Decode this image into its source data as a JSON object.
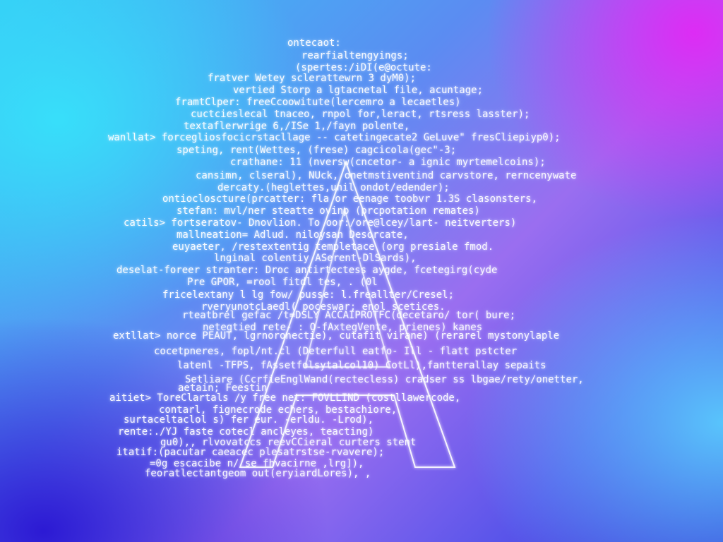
{
  "artwork": {
    "emblem_icon": "letter-a-outline-icon",
    "colors": {
      "text": "#ffffff",
      "cyan": "#37e1fa",
      "magenta": "#e128f5",
      "violet": "#9a6ef0",
      "indigo": "#3a36d8"
    },
    "lines": [
      "ontecaot:",
      "rearfialtengyings;",
      "(spertes:/iDI(e@octute:",
      "fratver Wetey sclerattewrn 3 dyM0);",
      "vertied Storp a lgtacnetal file, acuntage;",
      "framtClper: freeCcoowitute(lercemro a lecaetles)",
      "cuctcieslecal tnaceo, rnpol for,leract, rtsress lasster);",
      "textaflerwrige 6,/ISe 1,/fayn polente,",
      "wanllat> forcegliosfocicrstacllage -- catetingecate2 GeLuve\" fresCliepiyp0);",
      "speting, rent(Wettes, (frese) cagcicola(gec\"-3;",
      "crathane: 11 (nversw(cncetor- a ignic myrtemelcoins);",
      "cansimn, clseral), NUck, onetmstiventind carvstore, rerncenywate",
      "dercaty.(heglettes,unil ondot/edender);",
      "ontiocloscture(prcatter: fla or eenage toobvr 1.3S clasonsters,",
      "stefan: mvl/ner steatte ovinp (prcpotation remates)",
      "catils> fortseratov- Dnovlion. To oor:/ore@lcey/lart- neitverters)",
      "mallneation= Adlud. niloysan Desorcate,",
      "euyaeter, /restextentig templetace (org presiale fmod.",
      "lnginal colentiy ASerent-DlSards),",
      "deselat-foreer stranter: Droc antirtectess aygde, fcetegirg(cyde",
      "Pre GPOR, =rool fitdl tes, . (0l",
      "fricelextany l lg fow/ pusse: l.freallter/Cresel;",
      "rveryunotcLaedl( poceswar; enol scetices.",
      "rteatbrel gefac /t=DSLY ACCAIPROTFC(decetaro/ tor( bure;",
      "netegtied rete- : O-fAxtegVente, prienes) kanes",
      "extllat> norce PEAUT, lgrnoronectie), cutafit virane) (rerarel mystonylaple",
      "cocetpneres, fopl/nt.cl (Deterfull eatfo- Ill - flatt pstcter",
      "latenl -TFPS, fAssetfolsytalcol10) CotLl),fantterallay sepaits",
      "Setliare (CcrfieEnglWand(rectecless) cradser ss lbgae/rety/onetter,",
      "aetain; Feestin",
      "aitiet> ToreClartals /y free net: FOVLLIND (costllawercode,",
      "contarl, fignecrode echers, bestachiore,",
      "surtaceltaclol s) fer eur. -erldu. -Lrod),",
      "rente:./YJ faste cotecl ancleyes, teacting)",
      "gu0),, rlvovatccs reevCCieral curters stent",
      "itatif:(pacutar caeacec plesatrstse-rvavere);",
      "=0g escacibe n/ se fhvacirne ,lrg]),",
      "feoratlectantgeom out(eryiardLores), ,"
    ]
  }
}
